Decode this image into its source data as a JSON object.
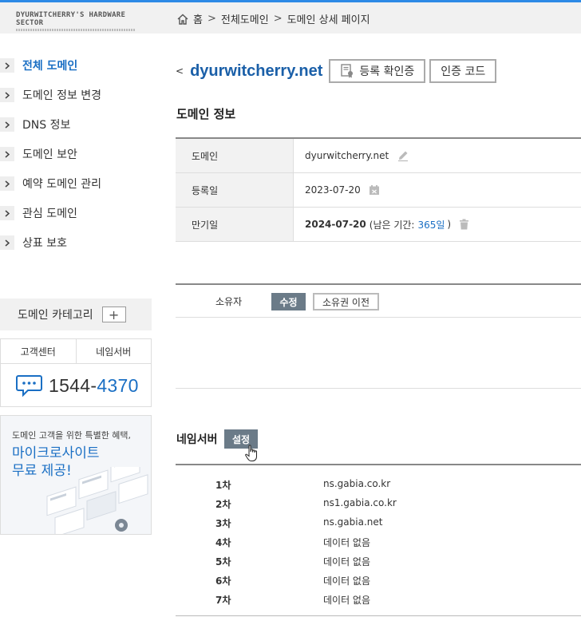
{
  "header": {
    "logo_text": "DYURWITCHERRY'S HARDWARE SECTOR",
    "breadcrumb": [
      {
        "label": "홈"
      },
      {
        "label": "전체도메인"
      },
      {
        "label": "도메인 상세 페이지"
      }
    ],
    "breadcrumb_sep": ">"
  },
  "sidebar": {
    "items": [
      {
        "label": "전체 도메인",
        "active": true
      },
      {
        "label": "도메인 정보 변경"
      },
      {
        "label": "DNS 정보"
      },
      {
        "label": "도메인 보안"
      },
      {
        "label": "예약 도메인 관리"
      },
      {
        "label": "관심 도메인"
      },
      {
        "label": "상표 보호"
      }
    ],
    "category_label": "도메인 카테고리",
    "category_add": "+",
    "support": {
      "tab_center": "고객센터",
      "tab_nameserver": "네임서버",
      "phone_prefix": "1544-",
      "phone_suffix": "4370"
    },
    "promo": {
      "small": "도메인 고객을 위한 특별한 혜택,",
      "big_line1": "마이크로사이트",
      "big_line2": "무료 제공!"
    }
  },
  "main": {
    "back": "<",
    "domain": "dyurwitcherry.net",
    "btn_certificate": "등록 확인증",
    "btn_auth_code": "인증 코드",
    "section_title": "도메인 정보",
    "info": {
      "domain_label": "도메인",
      "domain_value": "dyurwitcherry.net",
      "registered_label": "등록일",
      "registered_value": "2023-07-20",
      "expiry_label": "만기일",
      "expiry_value": "2024-07-20",
      "remaining_prefix": "(남은 기간:",
      "remaining_days": "365일",
      "remaining_suffix": ")"
    },
    "owner": {
      "label": "소유자",
      "edit": "수정",
      "transfer": "소유권 이전"
    },
    "nameserver": {
      "title": "네임서버",
      "setting": "설정",
      "rows": [
        {
          "ord": "1차",
          "value": "ns.gabia.co.kr"
        },
        {
          "ord": "2차",
          "value": "ns1.gabia.co.kr"
        },
        {
          "ord": "3차",
          "value": "ns.gabia.net"
        },
        {
          "ord": "4차",
          "value": "데이터 없음"
        },
        {
          "ord": "5차",
          "value": "데이터 없음"
        },
        {
          "ord": "6차",
          "value": "데이터 없음"
        },
        {
          "ord": "7차",
          "value": "데이터 없음"
        }
      ]
    }
  },
  "colors": {
    "accent": "#1a6fc4",
    "top_line": "#2d8ae6",
    "dark_button": "#6b7b88"
  }
}
